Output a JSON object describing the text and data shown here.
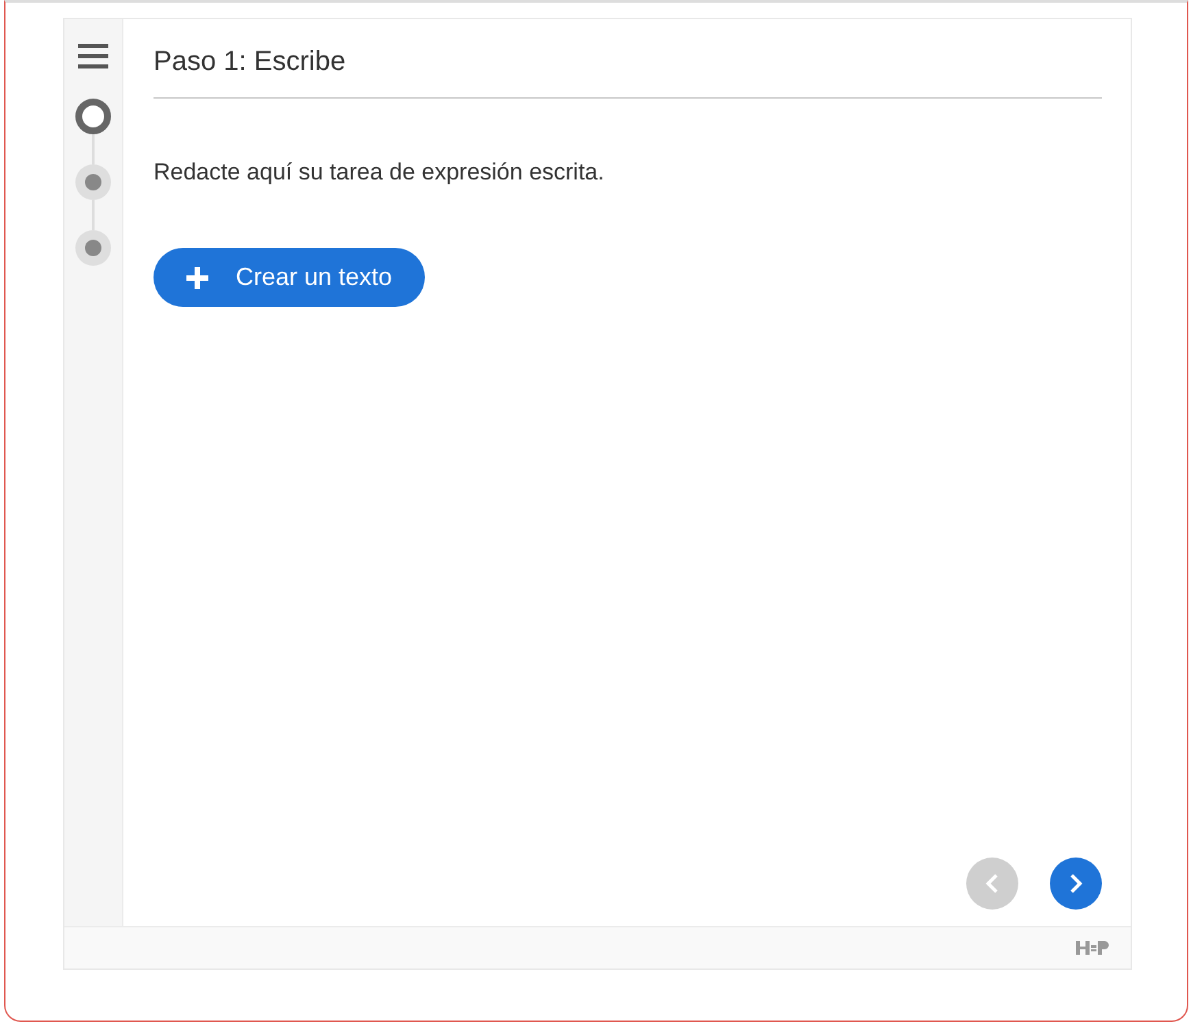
{
  "step_title": "Paso 1: Escribe",
  "instructions": "Redacte aquí su tarea de expresión escrita.",
  "create_button": {
    "label": "Crear un texto"
  },
  "steps": [
    {
      "selected": true
    },
    {
      "selected": false
    },
    {
      "selected": false
    }
  ],
  "navigation": {
    "previous_disabled": true,
    "next_disabled": false
  }
}
